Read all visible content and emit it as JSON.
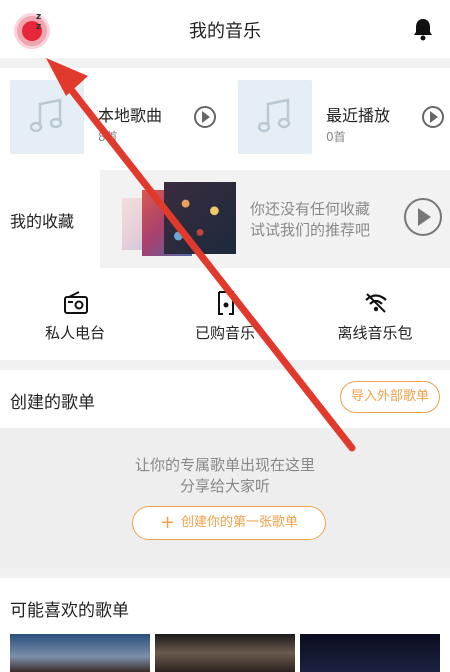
{
  "header": {
    "title": "我的音乐",
    "avatar_icon": "avatar-icon",
    "bell_icon": "bell-icon"
  },
  "cards": [
    {
      "title": "本地歌曲",
      "count": "8首",
      "icon": "music-note-icon"
    },
    {
      "title": "最近播放",
      "count": "0首",
      "icon": "music-note-icon"
    }
  ],
  "favorites": {
    "label": "我的收藏",
    "line1": "你还没有任何收藏",
    "line2": "试试我们的推荐吧"
  },
  "quick": [
    {
      "label": "私人电台",
      "icon": "radio-icon"
    },
    {
      "label": "已购音乐",
      "icon": "purchased-music-icon"
    },
    {
      "label": "离线音乐包",
      "icon": "offline-wifi-icon"
    }
  ],
  "playlists": {
    "title": "创建的歌单",
    "import_label": "导入外部歌单",
    "empty_line1": "让你的专属歌单出现在这里",
    "empty_line2": "分享给大家听",
    "create_label": "创建你的第一张歌单"
  },
  "recommend": {
    "title": "可能喜欢的歌单"
  },
  "colors": {
    "accent": "#f0a24a",
    "arrow": "#e2392d",
    "avatar": "#e6263a"
  }
}
